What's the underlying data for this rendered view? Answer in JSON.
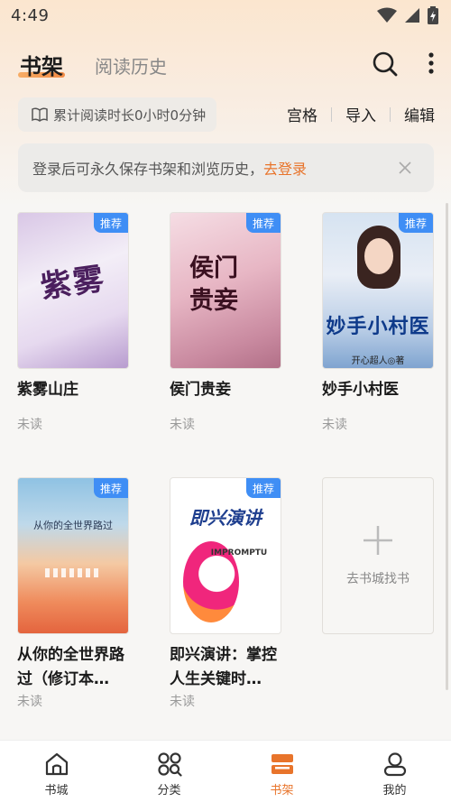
{
  "status_bar": {
    "time": "4:49"
  },
  "header": {
    "tabs": [
      {
        "label": "书架",
        "active": true
      },
      {
        "label": "阅读历史",
        "active": false
      }
    ],
    "icons": [
      "search-icon",
      "more-icon"
    ]
  },
  "reading_time": {
    "label": "累计阅读时长0小时0分钟",
    "icon": "book-open-icon"
  },
  "actions": {
    "grid": "宫格",
    "import": "导入",
    "edit": "编辑"
  },
  "login_banner": {
    "text": "登录后可永久保存书架和浏览历史，",
    "link": "去登录"
  },
  "books": [
    {
      "title": "紫雾山庄",
      "status": "未读",
      "badge": "推荐",
      "cover_text": "紫雾"
    },
    {
      "title": "侯门贵妾",
      "status": "未读",
      "badge": "推荐",
      "cover_text": "侯门贵妾"
    },
    {
      "title": "妙手小村医",
      "status": "未读",
      "badge": "推荐",
      "cover_text": "妙手小村医",
      "cover_author": "开心超人◎著"
    },
    {
      "title": "从你的全世界路过（修订本…",
      "status": "未读",
      "badge": "推荐",
      "cover_text": "从你的全世界路过"
    },
    {
      "title": "即兴演讲：掌控人生关键时…",
      "status": "未读",
      "badge": "推荐",
      "cover_text": "即兴演讲",
      "cover_sub": "IMPROMPTU"
    }
  ],
  "add_card": {
    "label": "去书城找书"
  },
  "bottom_nav": [
    {
      "label": "书城",
      "icon": "home-icon",
      "active": false
    },
    {
      "label": "分类",
      "icon": "category-icon",
      "active": false
    },
    {
      "label": "书架",
      "icon": "bookshelf-icon",
      "active": true
    },
    {
      "label": "我的",
      "icon": "profile-icon",
      "active": false
    }
  ],
  "colors": {
    "accent": "#e8742b",
    "badge": "#3f8ef5"
  }
}
